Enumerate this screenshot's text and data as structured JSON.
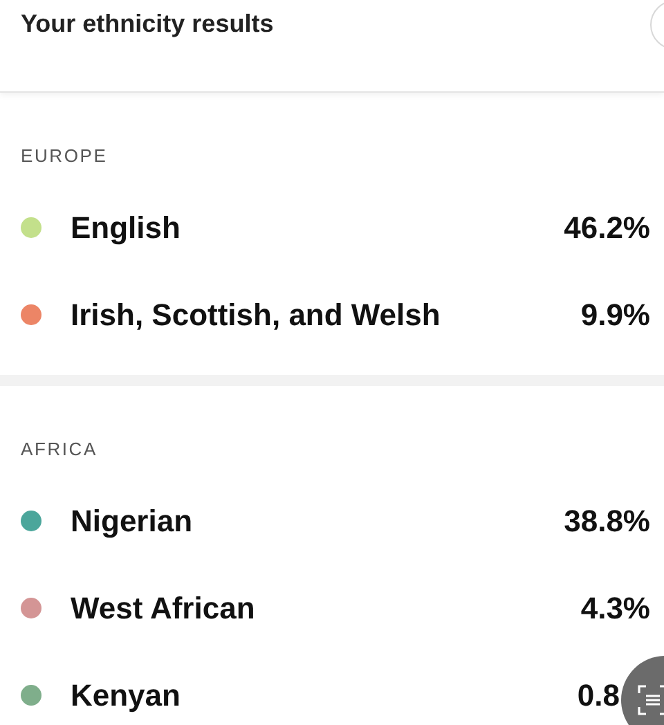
{
  "header": {
    "title": "Your ethnicity results"
  },
  "regions": [
    {
      "name": "EUROPE",
      "items": [
        {
          "name": "English",
          "percent": "46.2%",
          "color": "#c3e08b"
        },
        {
          "name": "Irish, Scottish, and Welsh",
          "percent": "9.9%",
          "color": "#ec8566"
        }
      ]
    },
    {
      "name": "AFRICA",
      "items": [
        {
          "name": "Nigerian",
          "percent": "38.8%",
          "color": "#4ba69b"
        },
        {
          "name": "West African",
          "percent": "4.3%",
          "color": "#d49595"
        },
        {
          "name": "Kenyan",
          "percent": "0.8",
          "color": "#7fae8b"
        }
      ]
    }
  ]
}
